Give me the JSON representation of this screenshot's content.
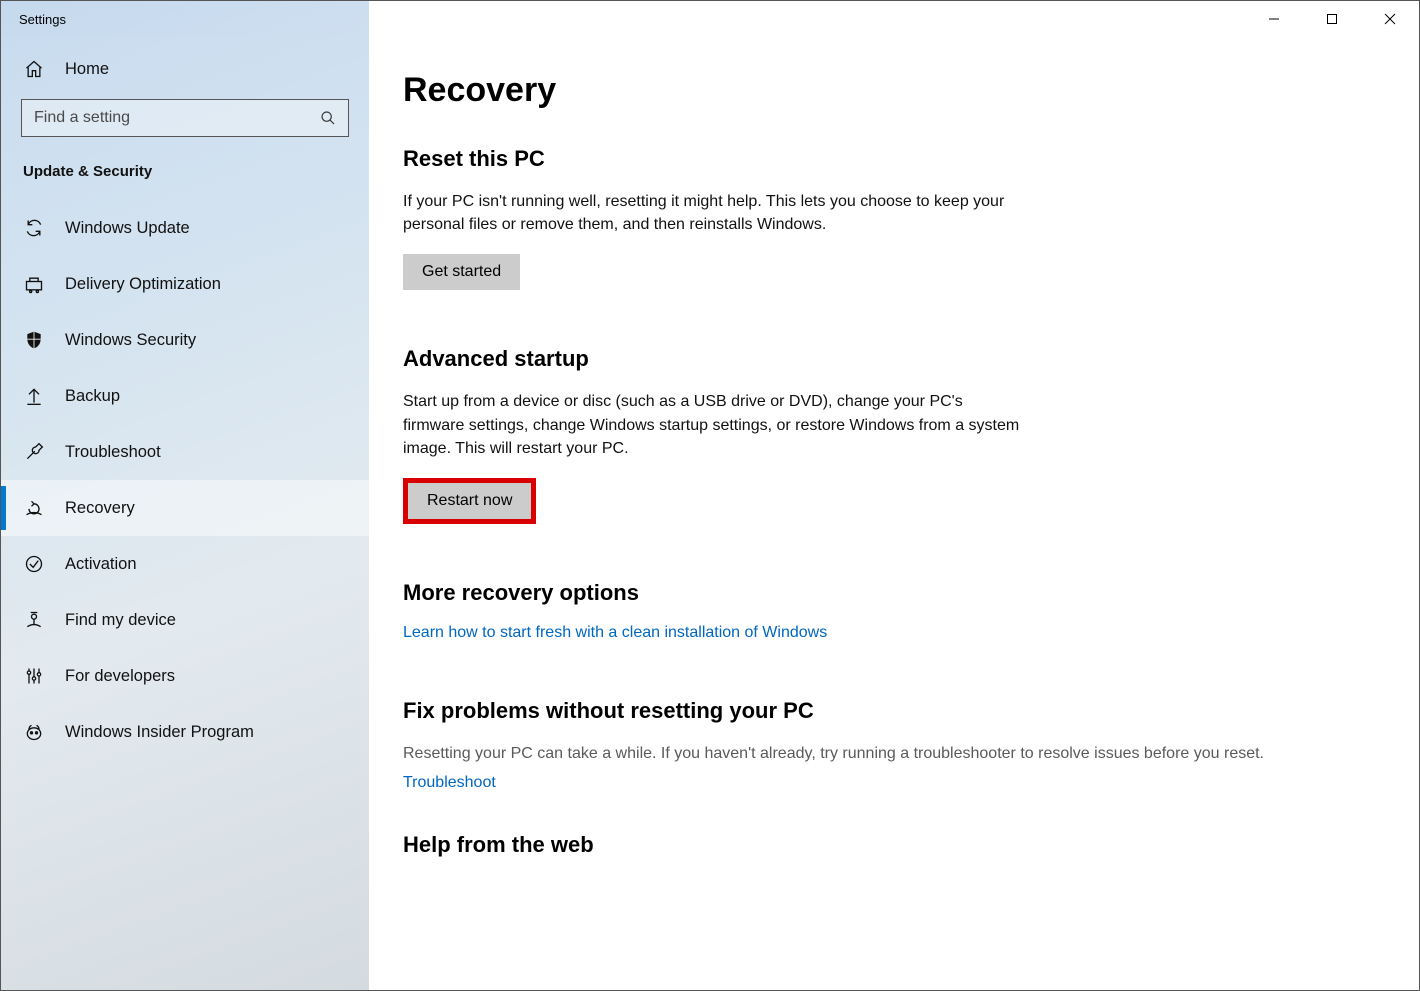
{
  "window": {
    "title": "Settings"
  },
  "sidebar": {
    "home_label": "Home",
    "search_placeholder": "Find a setting",
    "category": "Update & Security",
    "items": [
      {
        "id": "windows-update",
        "label": "Windows Update"
      },
      {
        "id": "delivery-optimization",
        "label": "Delivery Optimization"
      },
      {
        "id": "windows-security",
        "label": "Windows Security"
      },
      {
        "id": "backup",
        "label": "Backup"
      },
      {
        "id": "troubleshoot",
        "label": "Troubleshoot"
      },
      {
        "id": "recovery",
        "label": "Recovery"
      },
      {
        "id": "activation",
        "label": "Activation"
      },
      {
        "id": "find-my-device",
        "label": "Find my device"
      },
      {
        "id": "for-developers",
        "label": "For developers"
      },
      {
        "id": "windows-insider",
        "label": "Windows Insider Program"
      }
    ],
    "selected": "recovery"
  },
  "content": {
    "title": "Recovery",
    "reset": {
      "heading": "Reset this PC",
      "desc": "If your PC isn't running well, resetting it might help. This lets you choose to keep your personal files or remove them, and then reinstalls Windows.",
      "button": "Get started"
    },
    "advanced": {
      "heading": "Advanced startup",
      "desc": "Start up from a device or disc (such as a USB drive or DVD), change your PC's firmware settings, change Windows startup settings, or restore Windows from a system image. This will restart your PC.",
      "button": "Restart now"
    },
    "more": {
      "heading": "More recovery options",
      "link": "Learn how to start fresh with a clean installation of Windows"
    },
    "fix": {
      "heading": "Fix problems without resetting your PC",
      "desc": "Resetting your PC can take a while. If you haven't already, try running a troubleshooter to resolve issues before you reset.",
      "link": "Troubleshoot"
    },
    "help": {
      "heading": "Help from the web"
    }
  }
}
